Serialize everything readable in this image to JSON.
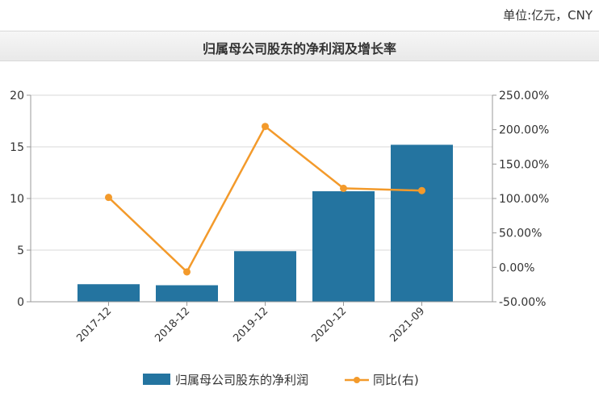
{
  "unit_label": "单位:亿元，CNY",
  "colors": {
    "bar": "#2474a0",
    "line": "#f39a2b",
    "grid": "#d8d8d8",
    "axis": "#999999"
  },
  "chart_data": {
    "type": "bar+line",
    "title": "归属母公司股东的净利润及增长率",
    "categories": [
      "2017-12",
      "2018-12",
      "2019-12",
      "2020-12",
      "2021-09"
    ],
    "series": [
      {
        "name": "归属母公司股东的净利润",
        "type": "bar",
        "axis": "left",
        "values": [
          1.7,
          1.6,
          4.9,
          10.7,
          15.2
        ]
      },
      {
        "name": "同比(右)",
        "type": "line",
        "axis": "right",
        "values": [
          1.0157,
          -0.0657,
          2.0465,
          1.1478,
          1.1145
        ]
      }
    ],
    "y_left": {
      "min": 0,
      "max": 20,
      "ticks": [
        "0",
        "5",
        "10",
        "15",
        "20"
      ]
    },
    "y_right": {
      "min": -0.5,
      "max": 2.5,
      "ticks": [
        "-50.00%",
        "0.00%",
        "50.00%",
        "100.00%",
        "150.00%",
        "200.00%",
        "250.00%"
      ]
    },
    "grid": true,
    "legend_position": "bottom"
  }
}
